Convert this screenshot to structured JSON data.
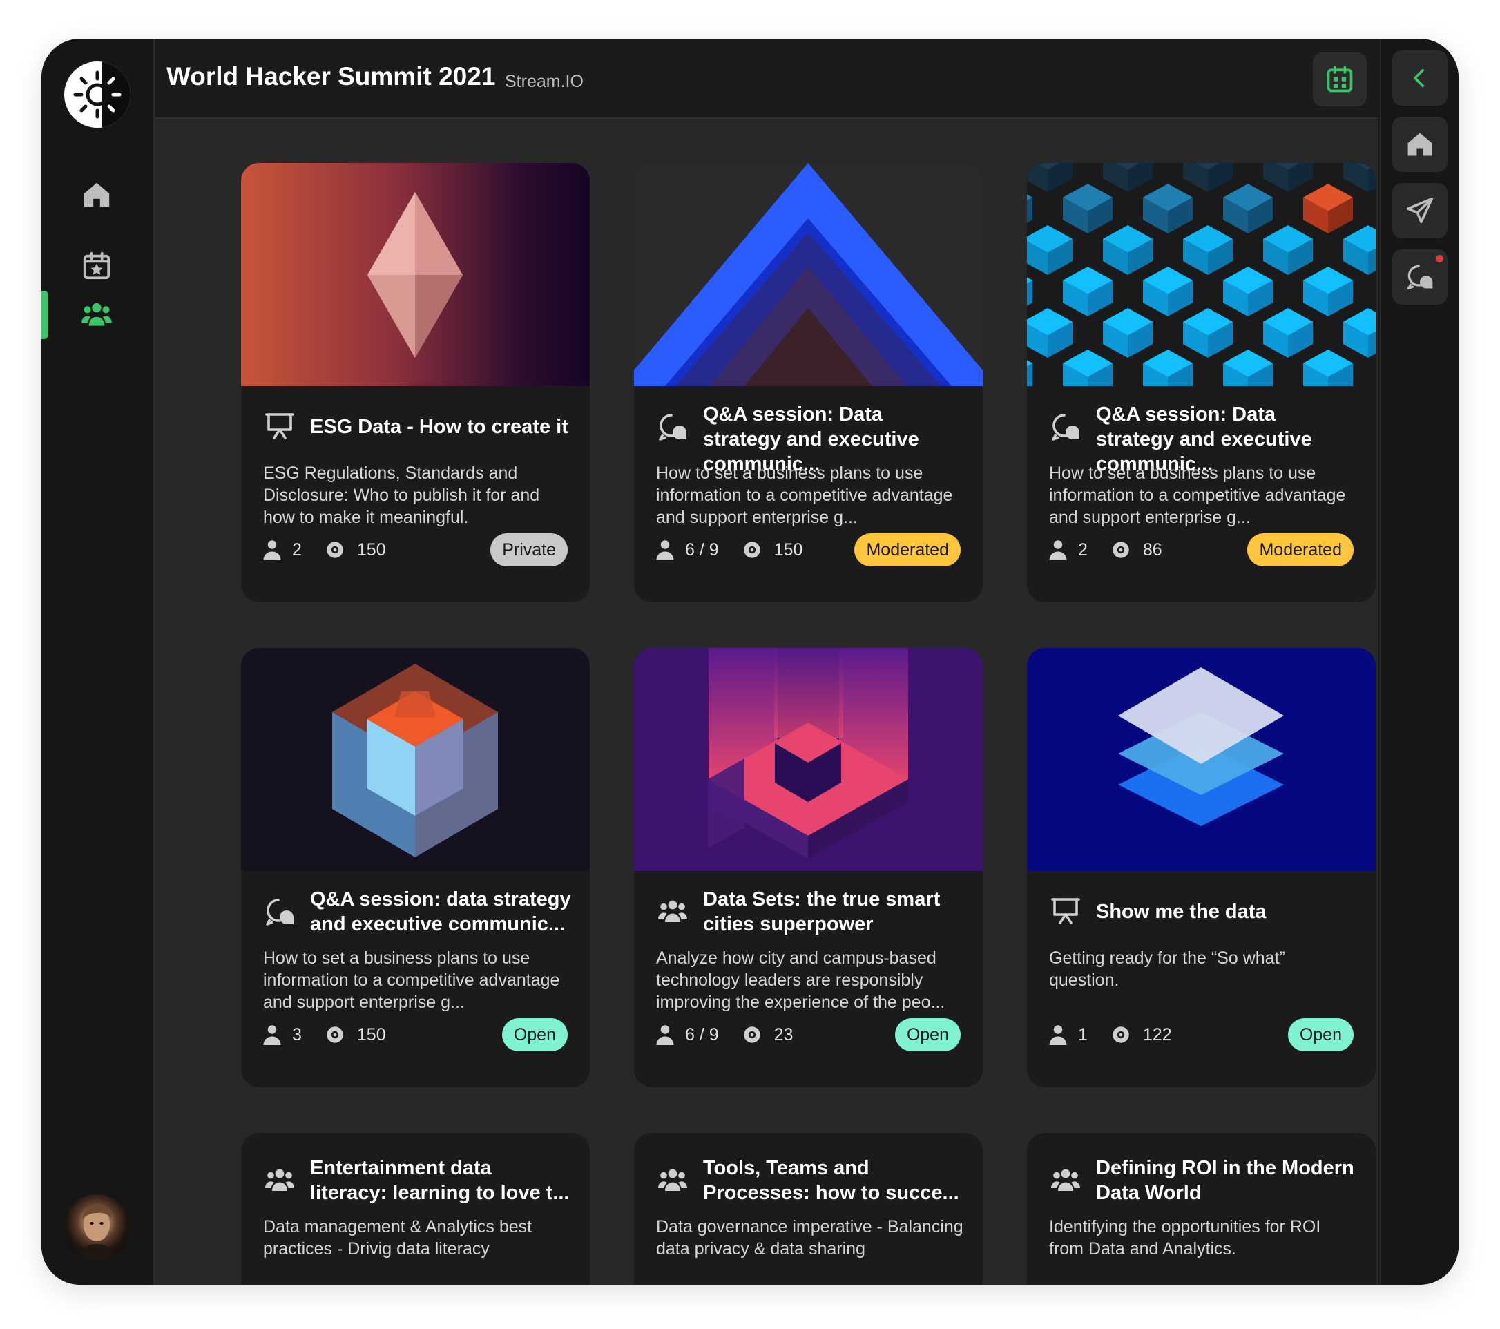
{
  "header": {
    "title": "World Hacker Summit 2021",
    "subtitle": "Stream.IO"
  },
  "left_nav": [
    "home-icon",
    "calendar-star-icon",
    "people-icon"
  ],
  "right_nav": [
    "chevron-left-icon",
    "home-icon",
    "send-icon",
    "chat-icon"
  ],
  "colors": {
    "accent_green": "#3cc46a",
    "badge_private": "#c9c9c9",
    "badge_moderated": "#ffc53d",
    "badge_open": "#7ff2d2",
    "notification_dot": "#e53935"
  },
  "cards": [
    {
      "title": "ESG Data - How to create it",
      "description": "ESG Regulations, Standards and Disclosure: Who to publish it for and how to make it meaningful.",
      "participants": "2",
      "views": "150",
      "status": "Private",
      "icon": "presentation-icon",
      "image": "crystal"
    },
    {
      "title": "Q&A session: Data strategy and executive communic...",
      "description": "How to set a business plans to use information to a competitive advantage and support enterprise g...",
      "participants": "6 / 9",
      "views": "150",
      "status": "Moderated",
      "icon": "chat-icon",
      "image": "chevrons"
    },
    {
      "title": "Q&A session: Data strategy and executive communic...",
      "description": "How to set a business plans to use information to a competitive advantage and support enterprise g...",
      "participants": "2",
      "views": "86",
      "status": "Moderated",
      "icon": "chat-icon",
      "image": "cubes"
    },
    {
      "title": "Q&A session: data strategy and executive communic...",
      "description": "How to set a business plans to use information to a competitive advantage and support enterprise g...",
      "participants": "3",
      "views": "150",
      "status": "Open",
      "icon": "chat-icon",
      "image": "box"
    },
    {
      "title": "Data Sets: the true smart cities superpower",
      "description": "Analyze how city and campus-based technology leaders are responsibly improving the experience of the peo...",
      "participants": "6 / 9",
      "views": "23",
      "status": "Open",
      "icon": "people-icon",
      "image": "pillars"
    },
    {
      "title": "Show me the data",
      "description": "Getting ready for the “So what” question.",
      "participants": "1",
      "views": "122",
      "status": "Open",
      "icon": "presentation-icon",
      "image": "layers"
    },
    {
      "title": "Entertainment data literacy: learning to love t...",
      "description": "Data management & Analytics best practices - Drivig data literacy",
      "icon": "people-icon"
    },
    {
      "title": "Tools, Teams and Processes: how to succe...",
      "description": "Data governance imperative - Balancing data privacy & data sharing",
      "icon": "people-icon"
    },
    {
      "title": "Defining ROI in the Modern Data World",
      "description": "Identifying the opportunities for ROI from Data and Analytics.",
      "icon": "people-icon"
    }
  ]
}
